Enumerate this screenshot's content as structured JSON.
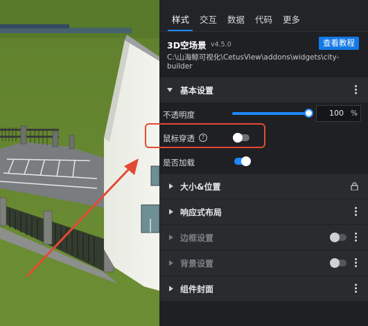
{
  "tabs": [
    {
      "label": "样式",
      "active": true
    },
    {
      "label": "交互",
      "active": false
    },
    {
      "label": "数据",
      "active": false
    },
    {
      "label": "代码",
      "active": false
    },
    {
      "label": "更多",
      "active": false
    }
  ],
  "component": {
    "name": "3D空场景",
    "version": "v4.5.0",
    "doc_button": "查看教程",
    "path": "C:\\山海鲸可视化\\CetusView\\addons\\widgets\\city-builder"
  },
  "basic_settings": {
    "title": "基本设置",
    "opacity": {
      "label": "不透明度",
      "value": "100",
      "unit": "%",
      "level_percent": 100
    },
    "mouse_through": {
      "label": "鼠标穿透",
      "help_icon": "question-circle-icon",
      "state": "off"
    },
    "loaded": {
      "label": "是否加载",
      "state": "on"
    }
  },
  "sections": [
    {
      "title": "大小&位置",
      "icon": "lock-icon",
      "enabled": true
    },
    {
      "title": "响应式布局",
      "icon": "more-icon",
      "enabled": true
    },
    {
      "title": "边框设置",
      "icon": "toggle-off",
      "enabled": false
    },
    {
      "title": "背景设置",
      "icon": "toggle-off",
      "enabled": false
    },
    {
      "title": "组件封面",
      "icon": "more-icon",
      "enabled": true
    }
  ],
  "colors": {
    "accent": "#1e88ff",
    "panel_bg": "#1f2023",
    "section_bg": "#2a2b2f",
    "highlight": "#e44a33"
  }
}
